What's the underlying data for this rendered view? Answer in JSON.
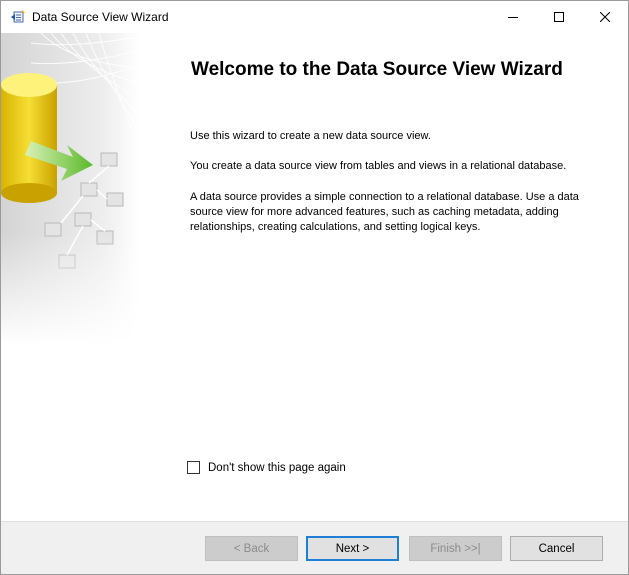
{
  "window": {
    "title": "Data Source View Wizard"
  },
  "icons": {
    "app": "data-source-view-wizard-icon",
    "minimize": "minimize-icon",
    "maximize": "maximize-icon",
    "close": "close-icon"
  },
  "page": {
    "heading": "Welcome to the Data Source View Wizard",
    "paragraphs": [
      "Use this wizard to create a new data source view.",
      "You create a data source view from tables and views in a relational database.",
      "A data source provides a simple connection to a relational database. Use a data source view for more advanced features, such as caching metadata, adding relationships, creating calculations, and setting logical keys."
    ],
    "dont_show": {
      "label": "Don't show this page again",
      "checked": false
    }
  },
  "buttons": {
    "back": "< Back",
    "next": "Next >",
    "finish": "Finish >>|",
    "cancel": "Cancel"
  },
  "colors": {
    "accent": "#1e7fd4",
    "disabled_button_bg": "#cccccc",
    "footer_bg": "#f0f0f0"
  }
}
